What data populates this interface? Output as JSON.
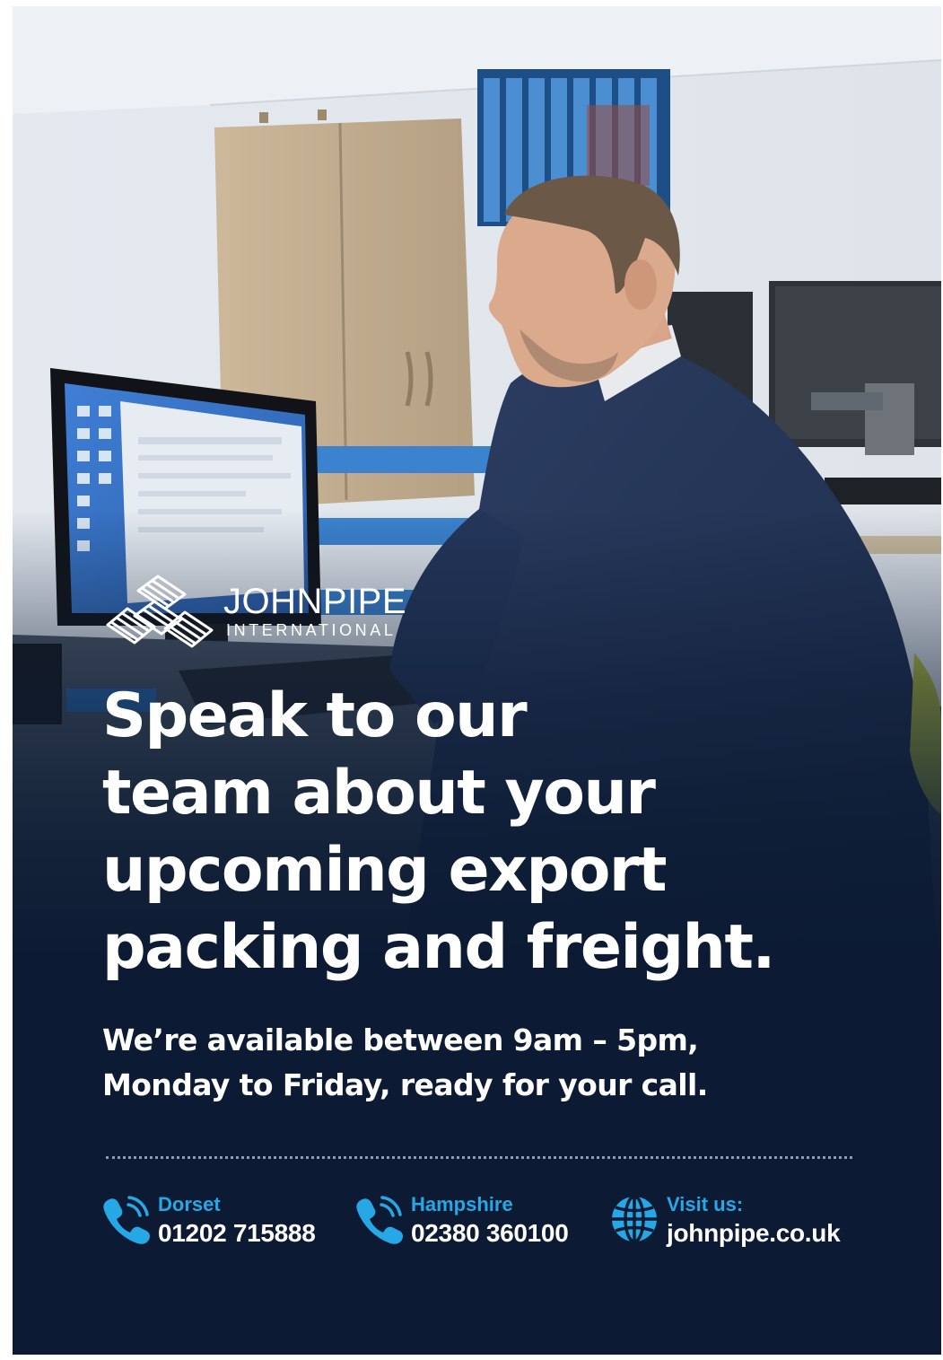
{
  "logo": {
    "name": "JOHNPIPE",
    "subtitle": "INTERNATIONAL"
  },
  "headline": {
    "lines": [
      "Speak to our",
      "team about your",
      "upcoming export",
      "packing and freight."
    ]
  },
  "subline": {
    "lines": [
      "We’re available between 9am – 5pm,",
      "Monday to Friday, ready for your call."
    ]
  },
  "contacts": [
    {
      "label": "Dorset",
      "value": "01202 715888",
      "icon": "phone-icon"
    },
    {
      "label": "Hampshire",
      "value": "02380 360100",
      "icon": "phone-icon"
    },
    {
      "label": "Visit us:",
      "value": "johnpipe.co.uk",
      "icon": "globe-icon"
    }
  ],
  "colors": {
    "navy_background": "#0c1b33",
    "accent_blue": "#27a8e6",
    "text": "#ffffff"
  }
}
